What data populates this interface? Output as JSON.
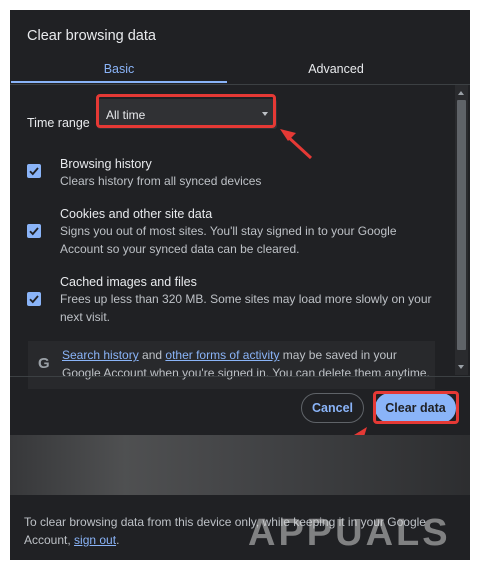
{
  "dialog": {
    "title": "Clear browsing data",
    "tabs": [
      {
        "label": "Basic",
        "active": true
      },
      {
        "label": "Advanced",
        "active": false
      }
    ],
    "time_range": {
      "label": "Time range",
      "value": "All time"
    },
    "options": [
      {
        "title": "Browsing history",
        "description": "Clears history from all synced devices",
        "checked": true
      },
      {
        "title": "Cookies and other site data",
        "description": "Signs you out of most sites. You'll stay signed in to your Google Account so your synced data can be cleared.",
        "checked": true
      },
      {
        "title": "Cached images and files",
        "description": "Frees up less than 320 MB. Some sites may load more slowly on your next visit.",
        "checked": true
      }
    ],
    "info": {
      "icon": "google-g-icon",
      "link1": "Search history",
      "mid": " and ",
      "link2": "other forms of activity",
      "rest": " may be saved in your Google Account when you're signed in. You can delete them anytime."
    },
    "buttons": {
      "cancel": "Cancel",
      "clear": "Clear data"
    }
  },
  "footer_note": {
    "text": "To clear browsing data from this device only, while keeping it in your Google Account, ",
    "link": "sign out",
    "end": "."
  },
  "watermark": "APPUALS",
  "colors": {
    "dialog_bg": "#202124",
    "accent": "#8ab4f8",
    "highlight": "#e53935"
  }
}
